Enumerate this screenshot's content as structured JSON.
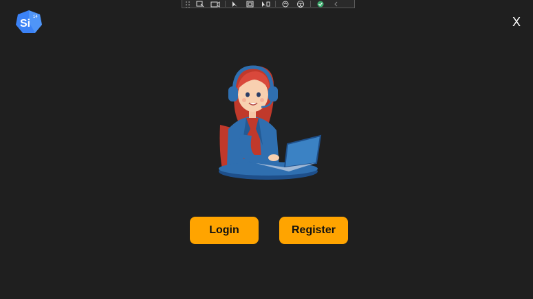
{
  "app": {
    "logo_text": "Si",
    "logo_badge": "14",
    "close_label": "X"
  },
  "toolbar": {
    "icons": [
      "select-element-icon",
      "video-icon",
      "select-icon",
      "layout-icon",
      "pointer-icon",
      "hot-reload-icon",
      "accessibility-icon",
      "check-icon",
      "chevron-left-icon"
    ]
  },
  "actions": {
    "login_label": "Login",
    "register_label": "Register"
  },
  "colors": {
    "background": "#1f1f1f",
    "button": "#ffa400",
    "logo_blue": "#3b82f6"
  }
}
